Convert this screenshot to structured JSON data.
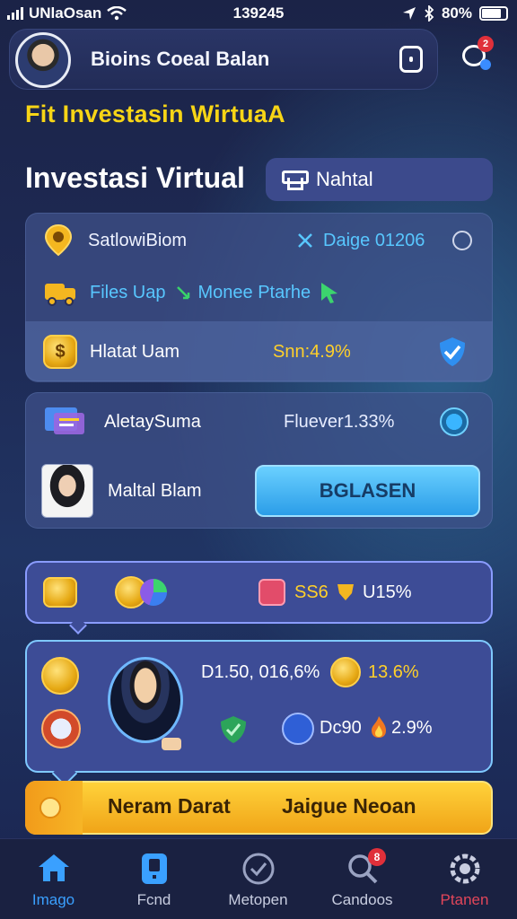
{
  "status_bar": {
    "carrier": "UNlaOsan",
    "time": "139245",
    "battery": "80%"
  },
  "header": {
    "user_name": "Bioins Coeal Balan",
    "notif_count": "2"
  },
  "promo_title": "Fit Investasin WirtuaA",
  "page_title": "Investasi Virtual",
  "filter": {
    "label": "Nahtal"
  },
  "card1": {
    "row1_label": "SatlowiBiom",
    "row1_value": "Daige 01206",
    "row2_left": "Files Uap",
    "row2_right": "Monee Ptarhe",
    "row3_label": "Hlatat Uam",
    "row3_value": "Snn:4.9%"
  },
  "card2": {
    "row1_label": "AletaySuma",
    "row1_value": "Fluever1.33%",
    "row2_label": "Maltal Blam",
    "action_label": "BGLASEN"
  },
  "card3": {
    "value1": "SS6",
    "value2": "U15%"
  },
  "card4": {
    "value1": "D1.50, 016,6%",
    "value2": "13.6%",
    "value3": "Dc90",
    "value4": "2.9%"
  },
  "banner": {
    "left": "Neram Darat",
    "right": "Jaigue Neoan"
  },
  "nav": {
    "tabs": [
      {
        "label": "Imago",
        "active": true
      },
      {
        "label": "Fcnd"
      },
      {
        "label": "Metopen"
      },
      {
        "label": "Candoos",
        "badge": "8"
      },
      {
        "label": "Ptanen"
      }
    ]
  },
  "colors": {
    "accent_yellow": "#f7d516",
    "accent_cyan": "#58c7ff",
    "active_tab": "#3aa0ff",
    "alert_red": "#e0303a"
  }
}
